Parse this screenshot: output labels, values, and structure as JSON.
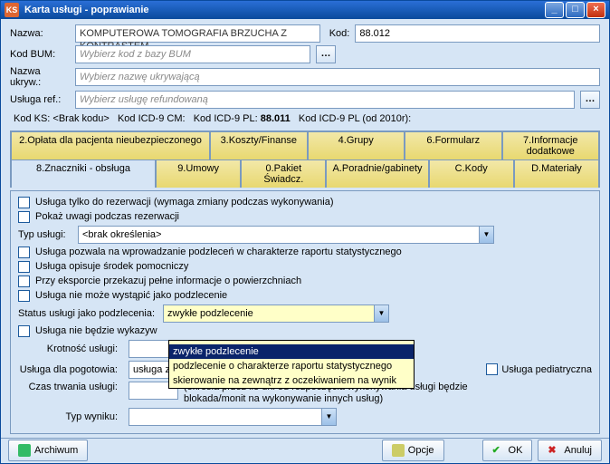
{
  "title": "Karta usługi - poprawianie",
  "fields": {
    "nazwa_lbl": "Nazwa:",
    "nazwa": "KOMPUTEROWA TOMOGRAFIA BRZUCHA Z KONTRASTEM",
    "kod_lbl": "Kod:",
    "kod": "88.012",
    "kodbum_lbl": "Kod BUM:",
    "kodbum_ph": "Wybierz kod z bazy BUM",
    "nazwaukr_lbl": "Nazwa ukryw.:",
    "nazwaukr_ph": "Wybierz nazwę ukrywającą",
    "uslref_lbl": "Usługa ref.:",
    "uslref_ph": "Wybierz usługę refundowaną"
  },
  "kodline": {
    "a": "Kod KS: <Brak kodu>",
    "b": "Kod ICD-9 CM:",
    "c": "Kod ICD-9 PL:",
    "c_val": "88.011",
    "d": "Kod ICD-9 PL (od 2010r):"
  },
  "tabs": {
    "r1": [
      "2.Opłata dla pacjenta nieubezpieczonego",
      "3.Koszty/Finanse",
      "4.Grupy",
      "6.Formularz",
      "7.Informacje dodatkowe"
    ],
    "r2": [
      "8.Znaczniki - obsługa",
      "9.Umowy",
      "0.Pakiet Świadcz.",
      "A.Poradnie/gabinety",
      "C.Kody",
      "D.Materiały"
    ]
  },
  "panel": {
    "chk1": "Usługa tylko do rezerwacji (wymaga zmiany podczas wykonywania)",
    "chk2": "Pokaż uwagi podczas rezerwacji",
    "typ_lbl": "Typ usługi:",
    "typ_val": "<brak określenia>",
    "chk3": "Usługa pozwala na wprowadzanie podzleceń w charakterze raportu statystycznego",
    "chk4": "Usługa opisuje środek pomocniczy",
    "chk5": "Przy eksporcie przekazuj pełne informacje o powierzchniach",
    "chk6": "Usługa nie może wystąpić jako podzlecenie",
    "status_lbl": "Status usługi jako podzlecenia:",
    "status_val": "zwykłe podzlecenie",
    "chk7": "Usługa nie będzie wykazyw",
    "krot_lbl": "Krotność usługi:",
    "pogo_lbl": "Usługa dla pogotowia:",
    "pogo_val": "usługa zwykła nie związana z pogotowiem",
    "pediatr": "Usługa pediatryczna",
    "czas_lbl": "Czas trwania usługi:",
    "czas_desc1": "(określa przez ile dni od rozpoczęcia wykonywania usługi będzie",
    "czas_desc2": "blokada/monit na wykonywanie innych usług)",
    "wynik_lbl": "Typ wyniku:"
  },
  "dropdown": {
    "o1": "",
    "o2": "zwykłe podzlecenie",
    "o3": "podzlecenie o charakterze raportu statystycznego",
    "o4": "skierowanie na zewnątrz z oczekiwaniem na wynik"
  },
  "buttons": {
    "arch": "Archiwum",
    "opcje": "Opcje",
    "ok": "OK",
    "anuluj": "Anuluj"
  }
}
